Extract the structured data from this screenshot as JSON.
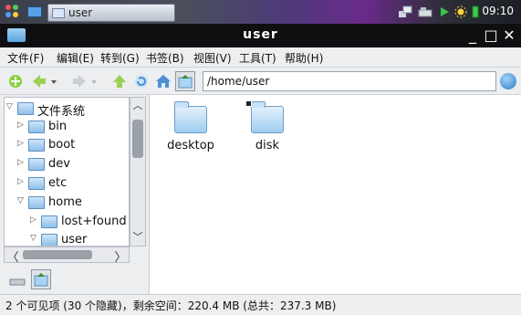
{
  "taskbar": {
    "window_tab": "user",
    "clock": "09:10"
  },
  "window": {
    "title": "user",
    "minimize": "_",
    "maximize": "□",
    "close": "✕"
  },
  "menu": [
    "文件(F)",
    "编辑(E)",
    "转到(G)",
    "书签(B)",
    "视图(V)",
    "工具(T)",
    "帮助(H)"
  ],
  "toolbar": {
    "path": "/home/user"
  },
  "tree": [
    {
      "label": "文件系统",
      "expander": "▽"
    },
    {
      "label": "bin",
      "expander": "▷"
    },
    {
      "label": "boot",
      "expander": "▷"
    },
    {
      "label": "dev",
      "expander": "▷"
    },
    {
      "label": "etc",
      "expander": "▷"
    },
    {
      "label": "home",
      "expander": "▽"
    },
    {
      "label": "lost+found",
      "expander": "▷"
    },
    {
      "label": "user",
      "expander": "▽"
    }
  ],
  "scroll": {
    "up": "︿",
    "down": "﹀",
    "left": "〈",
    "right": "〉"
  },
  "items": [
    {
      "name": "desktop"
    },
    {
      "name": "disk"
    }
  ],
  "status": "2 个可见项 (30 个隐藏)，剩余空间：220.4 MB (总共：237.3 MB)",
  "colors": {
    "title_bg": "#0f0f12",
    "bars_bg": "#eceef0",
    "folder_accent": "#9fcdf0"
  }
}
